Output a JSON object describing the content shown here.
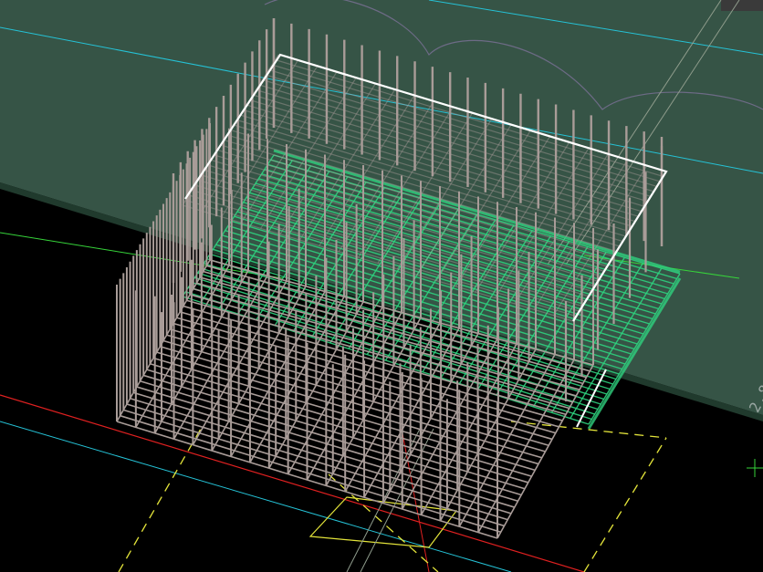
{
  "viewport": {
    "background": "#000000",
    "slab_fill": "#365446",
    "slab_edge": "#294437",
    "rebar_color": "#a99c98",
    "outline_color": "#ffffff",
    "lower_mesh_color": "#2fd17e",
    "cyan_line_color": "#25c2d6",
    "red_line_color": "#e02020",
    "yellow_line_color": "#e3e43a",
    "green_line_color": "#36d43a",
    "coord_readout_text": "2,8"
  }
}
